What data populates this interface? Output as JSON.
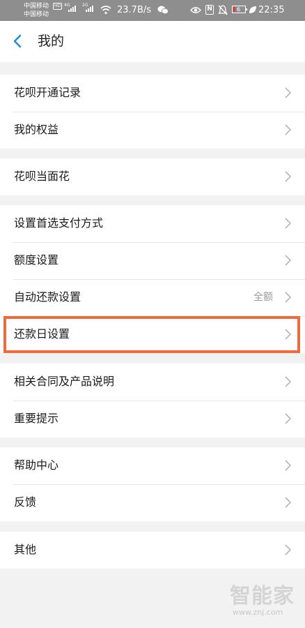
{
  "status_bar": {
    "carrier_1": "中国移动",
    "carrier_2": "中国移动",
    "hd_badge": "HD",
    "net_1": "4G",
    "net_2": "2G",
    "speed": "23.7B/s",
    "battery_level": "6",
    "time": "22:35",
    "icons": [
      "wifi-icon",
      "wechat-icon",
      "eye-icon",
      "nfc-icon",
      "mute-icon",
      "battery-icon",
      "leaf-icon"
    ]
  },
  "header": {
    "title": "我的",
    "back_icon": "chevron-left-icon",
    "accent_color": "#1f8fd6"
  },
  "groups": [
    {
      "items": [
        {
          "label": "花呗开通记录",
          "value": ""
        },
        {
          "label": "我的权益",
          "value": ""
        }
      ]
    },
    {
      "items": [
        {
          "label": "花呗当面花",
          "value": ""
        }
      ]
    },
    {
      "items": [
        {
          "label": "设置首选支付方式",
          "value": ""
        },
        {
          "label": "额度设置",
          "value": ""
        },
        {
          "label": "自动还款设置",
          "value": "全额"
        },
        {
          "label": "还款日设置",
          "value": "",
          "highlighted": true
        }
      ]
    },
    {
      "items": [
        {
          "label": "相关合同及产品说明",
          "value": ""
        },
        {
          "label": "重要提示",
          "value": ""
        }
      ]
    },
    {
      "items": [
        {
          "label": "帮助中心",
          "value": ""
        },
        {
          "label": "反馈",
          "value": ""
        }
      ]
    },
    {
      "items": [
        {
          "label": "其他",
          "value": ""
        }
      ]
    }
  ],
  "highlight_color": "#f26a3b",
  "watermark": {
    "text": "智能家",
    "url": "www.znj.com"
  }
}
